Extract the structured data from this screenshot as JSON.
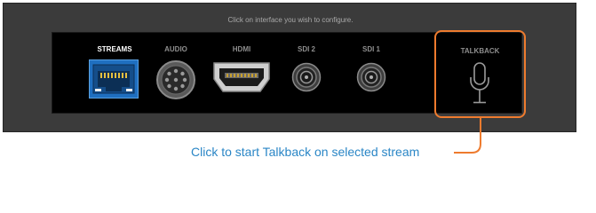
{
  "instruction": "Click on interface you wish to configure.",
  "interfaces": [
    {
      "label": "STREAMS",
      "active": true,
      "icon": "ethernet-port-icon"
    },
    {
      "label": "AUDIO",
      "active": false,
      "icon": "audio-din-connector-icon"
    },
    {
      "label": "HDMI",
      "active": false,
      "icon": "hdmi-port-icon"
    },
    {
      "label": "SDI 2",
      "active": false,
      "icon": "bnc-connector-icon"
    },
    {
      "label": "SDI 1",
      "active": false,
      "icon": "bnc-connector-icon"
    }
  ],
  "talkback": {
    "label": "TALKBACK",
    "icon": "microphone-icon"
  },
  "callout": "Click to start Talkback on selected stream",
  "colors": {
    "accent_orange": "#ee7b2e",
    "active_blue": "#1f6fc0",
    "callout_blue": "#2a86c6",
    "panel": "#3b3b3b",
    "bar": "#000000"
  }
}
